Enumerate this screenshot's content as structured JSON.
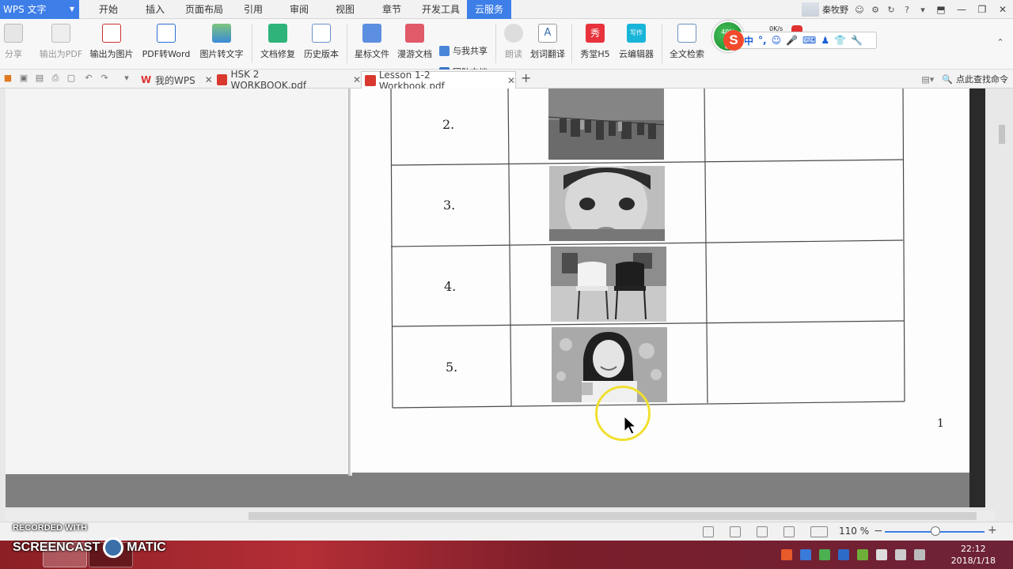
{
  "app": {
    "title": "WPS 文字"
  },
  "menu": {
    "items": [
      "开始",
      "插入",
      "页面布局",
      "引用",
      "审阅",
      "视图",
      "章节",
      "开发工具"
    ],
    "active": "云服务"
  },
  "user": {
    "name": "秦牧野"
  },
  "ribbon": {
    "share": "分享",
    "export_pdf": "输出为PDF",
    "export_image": "输出为图片",
    "pdf_to_word": "PDF转Word",
    "image_to_text": "图片转文字",
    "doc_repair": "文档修复",
    "history": "历史版本",
    "star_file": "星标文件",
    "roam_doc": "漫游文档",
    "share_with_me": "与我共享",
    "team_doc": "团队文档",
    "read_aloud": "朗读",
    "translate": "划词翻译",
    "xiutang": "秀堂H5",
    "cloud_editor": "云编辑器",
    "fulltext_search": "全文检索",
    "xiu_icon": "秀",
    "write_icon": "写作",
    "a_icon": "A"
  },
  "ime": {
    "badge": "49%",
    "speed": "0K/s",
    "mode": "中"
  },
  "tabs": {
    "wps_home": "我的WPS",
    "doc1": "HSK 2 WORKBOOK.pdf",
    "doc2": "Lesson 1-2 Workbook.pdf",
    "search": "点此查找命令"
  },
  "document": {
    "rows": [
      "2.",
      "3.",
      "4.",
      "5."
    ],
    "page_number": "1"
  },
  "status": {
    "zoom": "110 %"
  },
  "watermark": {
    "line1": "RECORDED WITH",
    "line2_a": "SCREENCAST",
    "line2_b": "MATIC"
  },
  "clock": {
    "time": "22:12",
    "date": "2018/1/18"
  },
  "colors": {
    "accent": "#3d7ee8",
    "ime_green": "#2ba545",
    "ime_red": "#f24b2c"
  }
}
